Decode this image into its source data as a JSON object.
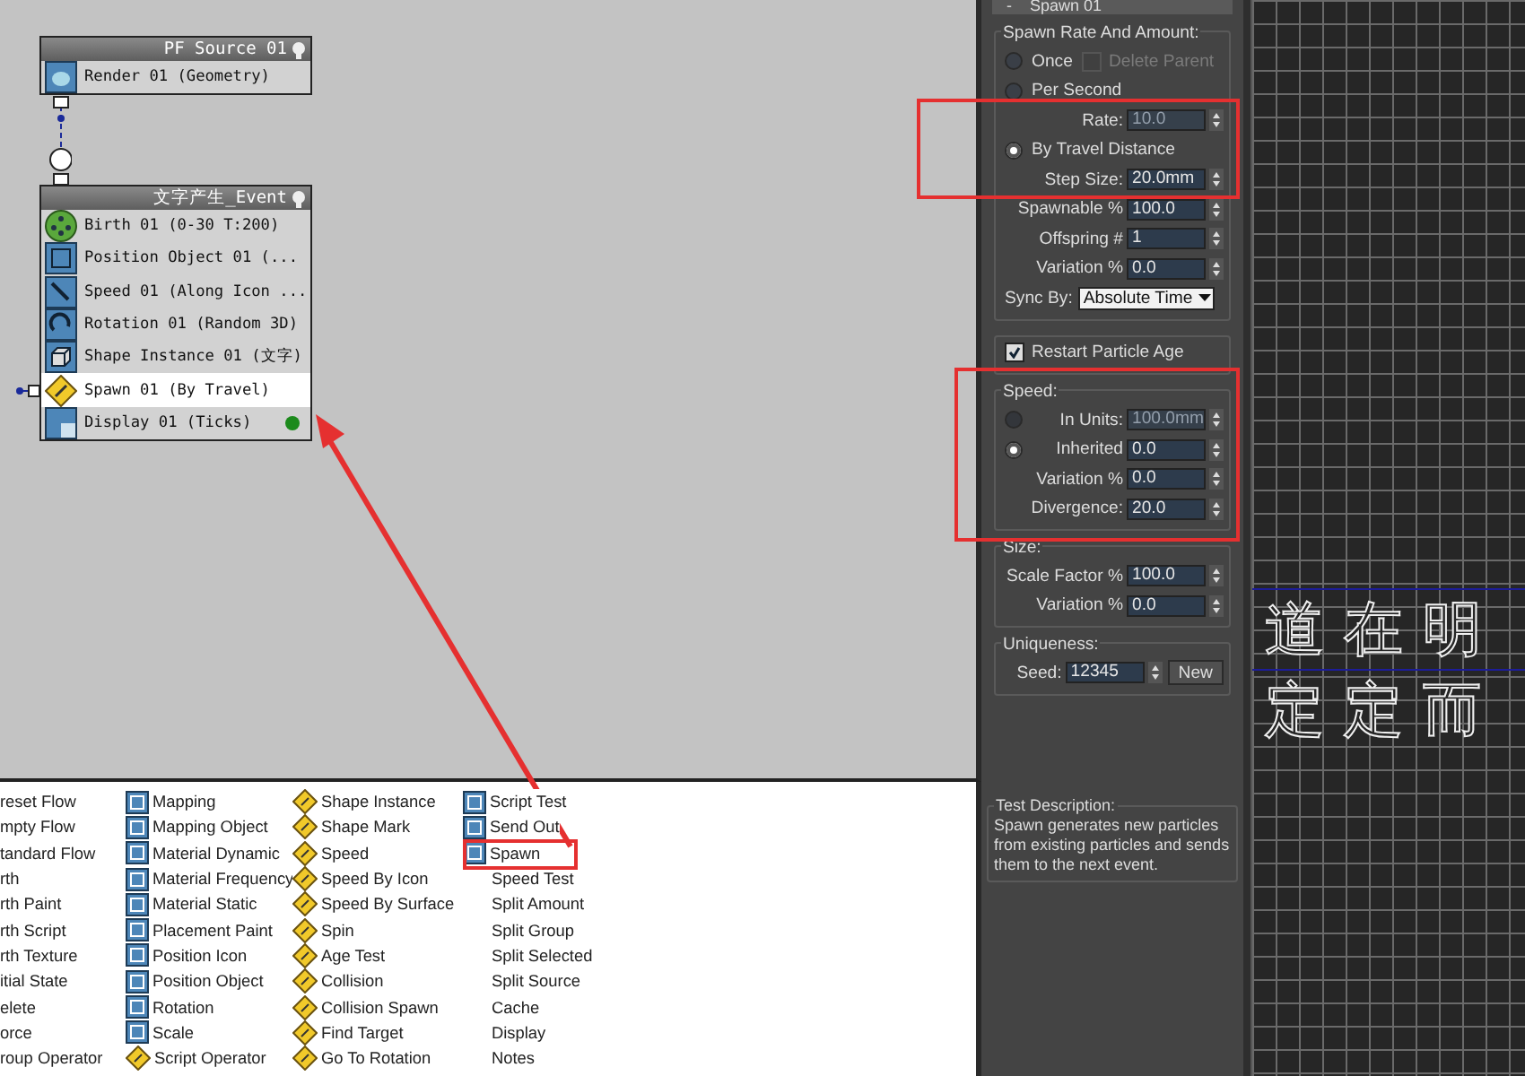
{
  "flow": {
    "nodes": [
      {
        "title": "PF Source 01",
        "items": [
          {
            "label": "Render 01 (Geometry)",
            "kind": "render",
            "selected": false
          }
        ]
      },
      {
        "title": "文字产生_Event",
        "items": [
          {
            "label": "Birth 01 (0-30 T:200)",
            "kind": "birth",
            "selected": false
          },
          {
            "label": "Position Object 01 (...",
            "kind": "position",
            "selected": false
          },
          {
            "label": "Speed 01 (Along Icon ...",
            "kind": "speed",
            "selected": false
          },
          {
            "label": "Rotation 01 (Random 3D)",
            "kind": "rotation",
            "selected": false
          },
          {
            "label": "Shape Instance 01 (文字)",
            "kind": "shape",
            "selected": false
          },
          {
            "label": "Spawn 01 (By Travel)",
            "kind": "test",
            "selected": true
          },
          {
            "label": "Display 01 (Ticks)",
            "kind": "display",
            "selected": false
          }
        ]
      }
    ]
  },
  "depot": {
    "columns": [
      [
        {
          "label": "reset Flow",
          "kind": "none"
        },
        {
          "label": "mpty Flow",
          "kind": "none"
        },
        {
          "label": "tandard Flow",
          "kind": "none"
        },
        {
          "label": "rth",
          "kind": "none"
        },
        {
          "label": "rth Paint",
          "kind": "none"
        },
        {
          "label": "rth Script",
          "kind": "none"
        },
        {
          "label": "rth Texture",
          "kind": "none"
        },
        {
          "label": "itial State",
          "kind": "none"
        },
        {
          "label": "elete",
          "kind": "none"
        },
        {
          "label": "orce",
          "kind": "none"
        },
        {
          "label": "roup Operator",
          "kind": "none"
        }
      ],
      [
        {
          "label": "Mapping",
          "kind": "operator"
        },
        {
          "label": "Mapping Object",
          "kind": "operator"
        },
        {
          "label": "Material Dynamic",
          "kind": "operator"
        },
        {
          "label": "Material Frequency",
          "kind": "operator"
        },
        {
          "label": "Material Static",
          "kind": "operator"
        },
        {
          "label": "Placement Paint",
          "kind": "operator"
        },
        {
          "label": "Position Icon",
          "kind": "operator"
        },
        {
          "label": "Position Object",
          "kind": "operator"
        },
        {
          "label": "Rotation",
          "kind": "operator"
        },
        {
          "label": "Scale",
          "kind": "operator"
        },
        {
          "label": "Script Operator",
          "kind": "test"
        }
      ],
      [
        {
          "label": "Shape Instance",
          "kind": "test"
        },
        {
          "label": "Shape Mark",
          "kind": "test"
        },
        {
          "label": "Speed",
          "kind": "test"
        },
        {
          "label": "Speed By Icon",
          "kind": "test"
        },
        {
          "label": "Speed By Surface",
          "kind": "test"
        },
        {
          "label": "Spin",
          "kind": "test"
        },
        {
          "label": "Age Test",
          "kind": "test"
        },
        {
          "label": "Collision",
          "kind": "test"
        },
        {
          "label": "Collision Spawn",
          "kind": "test"
        },
        {
          "label": "Find Target",
          "kind": "test"
        },
        {
          "label": "Go To Rotation",
          "kind": "test"
        }
      ],
      [
        {
          "label": "Script Test",
          "kind": "operator"
        },
        {
          "label": "Send Out",
          "kind": "operator"
        },
        {
          "label": "Spawn",
          "kind": "operator"
        },
        {
          "label": "Speed Test",
          "kind": "none"
        },
        {
          "label": "Split Amount",
          "kind": "none"
        },
        {
          "label": "Split Group",
          "kind": "none"
        },
        {
          "label": "Split Selected",
          "kind": "none"
        },
        {
          "label": "Split Source",
          "kind": "none"
        },
        {
          "label": "Cache",
          "kind": "none"
        },
        {
          "label": "Display",
          "kind": "none"
        },
        {
          "label": "Notes",
          "kind": "none"
        }
      ]
    ]
  },
  "panel": {
    "collapse": "-",
    "title": "Spawn 01",
    "groups": [
      {
        "title": "Spawn Rate And Amount:",
        "rows": [
          {
            "controls": [
              {
                "kind": "radio",
                "label": "Once",
                "selected": false,
                "disabled": false
              },
              {
                "kind": "checkbox",
                "label": "Delete Parent",
                "checked": false,
                "disabled": true
              }
            ]
          },
          {
            "controls": [
              {
                "kind": "radio",
                "label": "Per Second",
                "selected": false,
                "disabled": false
              }
            ]
          },
          {
            "controls": [
              {
                "kind": "spinner",
                "label": "Rate:",
                "value": "10.0",
                "disabled": true
              }
            ]
          },
          {
            "controls": [
              {
                "kind": "radio",
                "label": "By Travel Distance",
                "selected": true,
                "disabled": false
              }
            ]
          },
          {
            "controls": [
              {
                "kind": "spinner",
                "label": "Step Size:",
                "value": "20.0mm",
                "disabled": false
              }
            ]
          },
          {
            "controls": [
              {
                "kind": "spinner",
                "label": "Spawnable %",
                "value": "100.0",
                "disabled": false
              }
            ]
          },
          {
            "controls": [
              {
                "kind": "spinner",
                "label": "Offspring #",
                "value": "1",
                "disabled": false
              }
            ]
          },
          {
            "controls": [
              {
                "kind": "spinner",
                "label": "Variation %",
                "value": "0.0",
                "disabled": false
              }
            ]
          },
          {
            "controls": [
              {
                "kind": "dropdown",
                "label": "Sync By:",
                "value": "Absolute Time"
              }
            ]
          }
        ]
      },
      {
        "rows": [
          {
            "controls": [
              {
                "kind": "checkbox",
                "label": "Restart Particle Age",
                "checked": true,
                "disabled": false
              }
            ]
          }
        ]
      },
      {
        "title": "Speed:",
        "rows": [
          {
            "controls": [
              {
                "kind": "radio",
                "selected": false,
                "disabled": true
              },
              {
                "kind": "spinner",
                "label": "In Units:",
                "value": "100.0mm",
                "disabled": true
              }
            ]
          },
          {
            "controls": [
              {
                "kind": "radio",
                "selected": true,
                "disabled": false
              },
              {
                "kind": "spinner",
                "label": "Inherited",
                "value": "0.0",
                "disabled": false
              }
            ]
          },
          {
            "controls": [
              {
                "kind": "spinner",
                "label": "Variation %",
                "value": "0.0",
                "disabled": false
              }
            ]
          },
          {
            "controls": [
              {
                "kind": "spinner",
                "label": "Divergence:",
                "value": "20.0",
                "disabled": false
              }
            ]
          }
        ]
      },
      {
        "title": "Size:",
        "rows": [
          {
            "controls": [
              {
                "kind": "spinner",
                "label": "Scale Factor %",
                "value": "100.0",
                "disabled": false
              }
            ]
          },
          {
            "controls": [
              {
                "kind": "spinner",
                "label": "Variation %",
                "value": "0.0",
                "disabled": false
              }
            ]
          }
        ]
      },
      {
        "title": "Uniqueness:",
        "rows": [
          {
            "controls": [
              {
                "kind": "spinner",
                "label": "Seed:",
                "value": "12345",
                "disabled": false
              },
              {
                "kind": "button",
                "label": "New"
              }
            ]
          }
        ]
      }
    ],
    "description": {
      "title": "Test Description:",
      "text": "Spawn generates new particles from existing particles and sends them to the next event."
    }
  },
  "viewport": {
    "lines": [
      "道在明",
      "定定而"
    ]
  }
}
